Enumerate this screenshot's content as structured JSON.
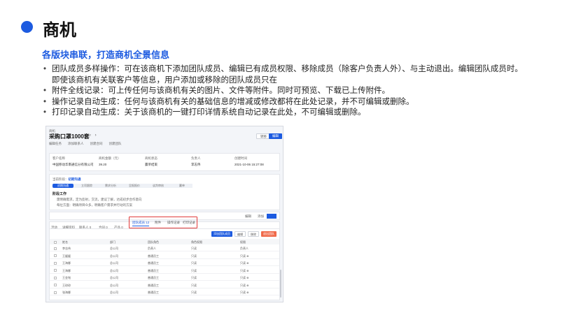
{
  "header": {
    "title": "商机"
  },
  "subtitle": "各版块串联，打造商机全景信息",
  "bullets": [
    "团队成员多样操作：可在该商机下添加团队成员、编辑已有成员权限、移除成员（除客户负责人外）、与主动退出。编辑团队成员时。",
    "即使该商机有关联客户等信息，用户添加或移除的团队成员只在",
    "附件全线记录：可上传任何与该商机有关的图片、文件等附件。同时可预览、下载已上传附件。",
    "操作记录自动生成：任何与该商机有关的基础信息的增减或修改都将在此处记录，并不可编辑或删除。",
    "打印记录自动生成：关于该商机的一键打印详情系统自动记录在此处，不可编辑或删除。"
  ],
  "screenshot": {
    "crumb": "商机",
    "title": "采购口罩1000套",
    "nav": "‹ ›",
    "actions": [
      "编辑任务",
      "添加联系人",
      "创建合同",
      "创建团队"
    ],
    "top_buttons": [
      "转移",
      "编辑"
    ],
    "info": [
      {
        "label": "客户名称",
        "value": "中国移动华南通信分有限公司"
      },
      {
        "label": "商机金额（元）",
        "value": "39.20"
      },
      {
        "label": "商机状态",
        "value": "赢单结束"
      },
      {
        "label": "负责人",
        "value": "李志伟"
      },
      {
        "label": "创建时间",
        "value": "2021-10-06 15:27:08"
      }
    ],
    "stage_label": "当前阶段：",
    "stage_value": "初期沟通",
    "steps": [
      "初期沟通",
      "立项跟踪",
      "需求分析",
      "呈报报价",
      "谈判审核",
      "赢单"
    ],
    "work_title": "阶段工作",
    "checklist": [
      "需明确需求，定为反射，交流，建议了解，达成初步合作意向",
      "每位方面：明确项目众多，明确客户需求并行动的方案"
    ],
    "note_buttons": [
      "编辑",
      "添加"
    ],
    "tabs": [
      "活动",
      "详细资料",
      "联系人 0",
      "合同 0",
      "产品 0"
    ],
    "red_tabs": [
      "团队成员 12",
      "附件",
      "操作记录",
      "打印记录"
    ],
    "table_buttons": [
      "添加团队成员",
      "编辑",
      "移除",
      "退出团队"
    ],
    "columns": [
      "姓名",
      "部门",
      "团队角色",
      "角色权限",
      "权限"
    ],
    "rows": [
      [
        "李志伟",
        "总公司",
        "负责人",
        "只读",
        "负责人"
      ],
      [
        "王媛媛",
        "总公司",
        "普通员工",
        "只读",
        "只读 ⊕"
      ],
      [
        "王海娜",
        "总公司",
        "普通员工",
        "只读",
        "只读 ⊕"
      ],
      [
        "王海娜",
        "总公司",
        "普通员工",
        "只读",
        "只读 ⊕"
      ],
      [
        "王金铭",
        "总公司",
        "普通员工",
        "只读",
        "只读 ⊕"
      ],
      [
        "王琼琼",
        "总公司",
        "普通员工",
        "只读",
        "只读 ⊕"
      ],
      [
        "张海娜",
        "总公司",
        "普通员工",
        "只读",
        "只读 ⊕"
      ]
    ]
  },
  "colors": {
    "accent": "#1d5be0",
    "highlight": "#e23b3b"
  }
}
